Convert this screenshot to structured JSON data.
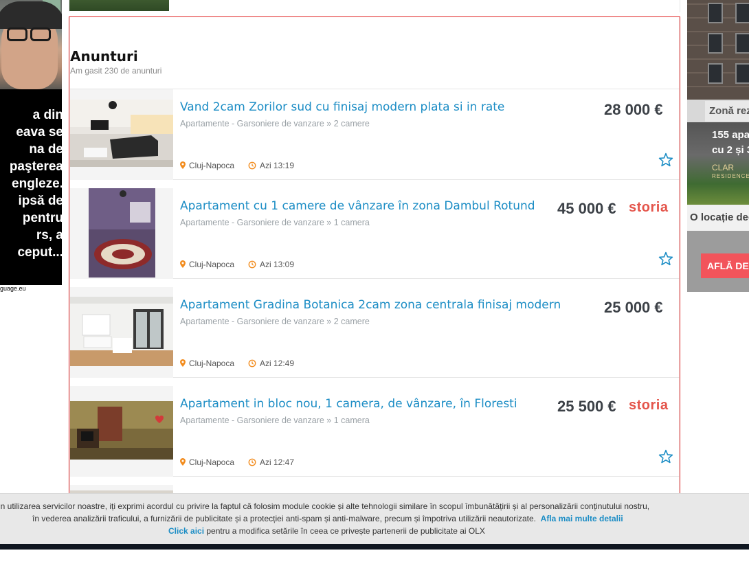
{
  "left_ad": {
    "text": "a din\neava se\nna de\npaşterea\nengleze.\nipsă de\n pentru\nrs, a\nceput...",
    "caption": "guage.eu"
  },
  "right_ad": {
    "zona": "Zonă rez",
    "apartments": "155 apa",
    "rooms": "cu 2 și 3",
    "logo": "CLAR",
    "logo_sub": "RESIDENCE",
    "location": "O locație dec",
    "cta": "AFLĂ DE"
  },
  "listing_header": {
    "title": "Anunturi",
    "subtitle": "Am gasit 230 de anunturi"
  },
  "colors": {
    "accent_blue": "#1c8dc5",
    "price": "#3c4147",
    "storia": "#e4554b",
    "pin_orange": "#f28c1e",
    "frame_red": "#e02020"
  },
  "listings": [
    {
      "title": "Vand 2cam Zorilor sud cu finisaj modern plata si in rate",
      "category": "Apartamente - Garsoniere de vanzare » 2 camere",
      "price": "28 000 €",
      "storia": "",
      "location": "Cluj-Napoca",
      "time": "Azi 13:19",
      "favorite_icon": "star-outline-icon"
    },
    {
      "title": "Apartament cu 1 camere de vânzare în zona Dambul Rotund",
      "category": "Apartamente - Garsoniere de vanzare » 1 camera",
      "price": "45 000 €",
      "storia": "storia",
      "location": "Cluj-Napoca",
      "time": "Azi 13:09",
      "favorite_icon": "star-outline-icon"
    },
    {
      "title": "Apartament Gradina Botanica 2cam zona centrala finisaj modern",
      "category": "Apartamente - Garsoniere de vanzare » 2 camere",
      "price": "25 000 €",
      "storia": "",
      "location": "Cluj-Napoca",
      "time": "Azi 12:49",
      "favorite_icon": ""
    },
    {
      "title": "Apartament in bloc nou, 1 camera, de vânzare, în Floresti",
      "category": "Apartamente - Garsoniere de vanzare » 1 camera",
      "price": "25 500 €",
      "storia": "storia",
      "location": "Cluj-Napoca",
      "time": "Azi 12:47",
      "favorite_icon": "star-outline-icon"
    }
  ],
  "cookie_bar": {
    "line1": "rin utilizarea servicilor noastre, iți exprimi acordul cu privire la faptul că folosim module cookie și alte tehnologii similare în scopul îmbunătățirii și al personalizării conținutului nostru,",
    "line2": "în vederea analizării traficului, a furnizării de publicitate și a protecției anti-spam și anti-malware, precum și împotriva utilizării neautorizate.",
    "more_link": "Afla mai multe detalii",
    "click_link": "Click aici",
    "line3": "pentru a modifica setările în ceea ce privește partenerii de publicitate ai OLX"
  }
}
